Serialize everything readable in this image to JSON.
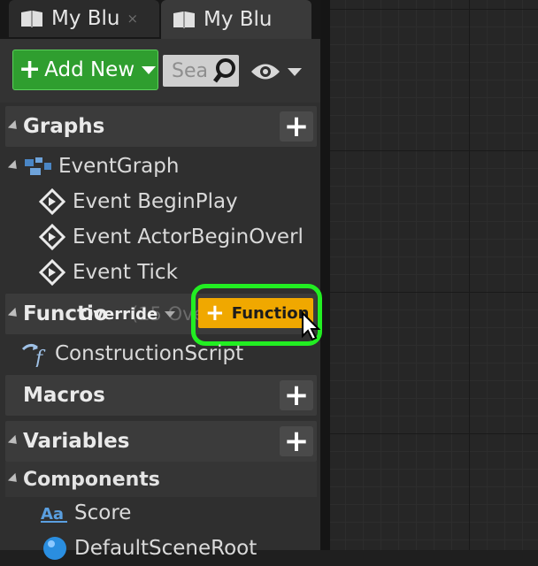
{
  "tabs": [
    {
      "label": "My Blu",
      "close": "×",
      "icon": "blueprint-book-icon"
    },
    {
      "label": "My Blu",
      "close": "",
      "icon": "blueprint-book-icon"
    }
  ],
  "toolbar": {
    "add_new_label": "Add New",
    "search_placeholder": "Sea",
    "visibility_icon": "eye-icon"
  },
  "sections": {
    "graphs": {
      "title": "Graphs",
      "items": [
        {
          "label": "EventGraph",
          "icon": "event-graph-icon"
        },
        {
          "label": "Event BeginPlay",
          "icon": "event-diamond-icon"
        },
        {
          "label": "Event ActorBeginOverl",
          "icon": "event-diamond-icon"
        },
        {
          "label": "Event Tick",
          "icon": "event-diamond-icon"
        }
      ]
    },
    "functions": {
      "title": "Functio",
      "hidden_text": "(15 Overridable)",
      "override_label": "Override",
      "add_function_label": "Function",
      "items": [
        {
          "label": "ConstructionScript",
          "icon": "function-icon"
        }
      ]
    },
    "macros": {
      "title": "Macros"
    },
    "variables": {
      "title": "Variables",
      "sub_title": "Components",
      "items": [
        {
          "label": "Score",
          "icon": "text-render-icon"
        },
        {
          "label": "DefaultSceneRoot",
          "icon": "scene-root-icon"
        }
      ]
    }
  },
  "colors": {
    "add_new": "#2f9e2f",
    "function_button": "#f0a800",
    "highlight": "#22ee22"
  }
}
